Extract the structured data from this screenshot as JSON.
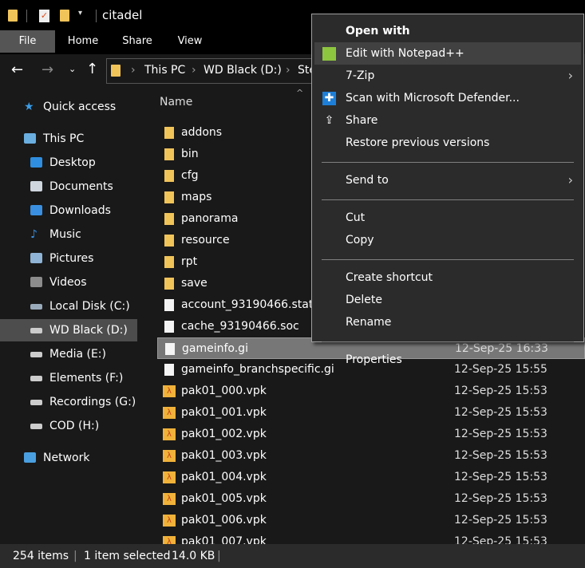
{
  "window": {
    "title": "citadel"
  },
  "ribbon": {
    "tabs": [
      "File",
      "Home",
      "Share",
      "View"
    ]
  },
  "address": {
    "crumbs": [
      "This PC",
      "WD Black (D:)",
      "Ste"
    ]
  },
  "nav": [
    {
      "label": "Quick access",
      "icon": "star-icon",
      "color": "#3b9de8"
    },
    {
      "label": "This PC",
      "icon": "computer-icon",
      "color": "#6aaee0"
    },
    {
      "label": "Desktop",
      "icon": "desktop-icon",
      "color": "#2f8ee0"
    },
    {
      "label": "Documents",
      "icon": "documents-icon",
      "color": "#cfd6de"
    },
    {
      "label": "Downloads",
      "icon": "downloads-icon",
      "color": "#3a8fe0"
    },
    {
      "label": "Music",
      "icon": "music-icon",
      "color": "#3a8fe0"
    },
    {
      "label": "Pictures",
      "icon": "pictures-icon",
      "color": "#8fb4d6"
    },
    {
      "label": "Videos",
      "icon": "videos-icon",
      "color": "#8c8c8c"
    },
    {
      "label": "Local Disk (C:)",
      "icon": "drive-icon",
      "color": "#9ab"
    },
    {
      "label": "WD Black (D:)",
      "icon": "drive-icon",
      "color": "#ccc"
    },
    {
      "label": "Media (E:)",
      "icon": "drive-icon",
      "color": "#ccc"
    },
    {
      "label": "Elements (F:)",
      "icon": "drive-icon",
      "color": "#ccc"
    },
    {
      "label": "Recordings (G:)",
      "icon": "drive-icon",
      "color": "#ccc"
    },
    {
      "label": "COD (H:)",
      "icon": "drive-icon",
      "color": "#ccc"
    },
    {
      "label": "Network",
      "icon": "network-icon",
      "color": "#4a9fe0"
    }
  ],
  "list": {
    "column_name": "Name",
    "files": [
      {
        "name": "addons",
        "type": "folder",
        "date": ""
      },
      {
        "name": "bin",
        "type": "folder",
        "date": ""
      },
      {
        "name": "cfg",
        "type": "folder",
        "date": ""
      },
      {
        "name": "maps",
        "type": "folder",
        "date": ""
      },
      {
        "name": "panorama",
        "type": "folder",
        "date": ""
      },
      {
        "name": "resource",
        "type": "folder",
        "date": ""
      },
      {
        "name": "rpt",
        "type": "folder",
        "date": ""
      },
      {
        "name": "save",
        "type": "folder",
        "date": ""
      },
      {
        "name": "account_93190466.stats",
        "type": "file",
        "date": ""
      },
      {
        "name": "cache_93190466.soc",
        "type": "file",
        "date": ""
      },
      {
        "name": "gameinfo.gi",
        "type": "file",
        "date": "12-Sep-25 16:33",
        "selected": true
      },
      {
        "name": "gameinfo_branchspecific.gi",
        "type": "file",
        "date": "12-Sep-25 15:55"
      },
      {
        "name": "pak01_000.vpk",
        "type": "vpk",
        "date": "12-Sep-25 15:53"
      },
      {
        "name": "pak01_001.vpk",
        "type": "vpk",
        "date": "12-Sep-25 15:53"
      },
      {
        "name": "pak01_002.vpk",
        "type": "vpk",
        "date": "12-Sep-25 15:53"
      },
      {
        "name": "pak01_003.vpk",
        "type": "vpk",
        "date": "12-Sep-25 15:53"
      },
      {
        "name": "pak01_004.vpk",
        "type": "vpk",
        "date": "12-Sep-25 15:53"
      },
      {
        "name": "pak01_005.vpk",
        "type": "vpk",
        "date": "12-Sep-25 15:53"
      },
      {
        "name": "pak01_006.vpk",
        "type": "vpk",
        "date": "12-Sep-25 15:53"
      },
      {
        "name": "pak01_007.vpk",
        "type": "vpk",
        "date": "12-Sep-25 15:53"
      }
    ]
  },
  "menu": {
    "items": [
      {
        "label": "Open with",
        "bold": true
      },
      {
        "label": "Edit with Notepad++",
        "icon": "notepadpp-icon",
        "highlighted": true
      },
      {
        "label": "7-Zip",
        "submenu": true
      },
      {
        "label": "Scan with Microsoft Defender...",
        "icon": "defender-icon"
      },
      {
        "label": "Share",
        "icon": "share-icon"
      },
      {
        "label": "Restore previous versions"
      },
      {
        "sep": true
      },
      {
        "label": "Send to",
        "submenu": true
      },
      {
        "sep": true
      },
      {
        "label": "Cut"
      },
      {
        "label": "Copy"
      },
      {
        "sep": true
      },
      {
        "label": "Create shortcut"
      },
      {
        "label": "Delete"
      },
      {
        "label": "Rename"
      },
      {
        "sep": true
      },
      {
        "label": "Properties"
      }
    ]
  },
  "status": {
    "items": "254 items",
    "selected": "1 item selected",
    "size": "14.0 KB"
  }
}
